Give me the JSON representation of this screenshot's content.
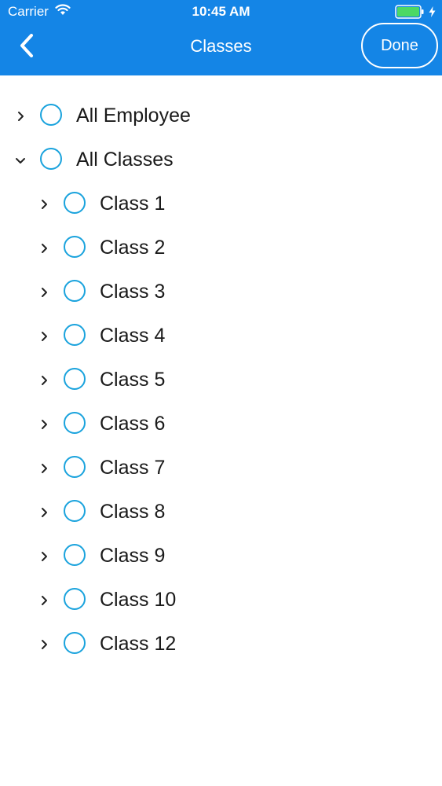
{
  "status_bar": {
    "carrier": "Carrier",
    "time": "10:45 AM",
    "battery_level": 1.0
  },
  "nav": {
    "title": "Classes",
    "done_label": "Done"
  },
  "colors": {
    "header_bg": "#1485e6",
    "radio_border": "#1aa3dd",
    "battery_fill": "#4cd964"
  },
  "tree": {
    "root_items": [
      {
        "label": "All Employee",
        "expanded": false
      },
      {
        "label": "All Classes",
        "expanded": true
      }
    ],
    "classes": [
      {
        "label": "Class 1"
      },
      {
        "label": "Class 2"
      },
      {
        "label": "Class 3"
      },
      {
        "label": "Class 4"
      },
      {
        "label": "Class 5"
      },
      {
        "label": "Class 6"
      },
      {
        "label": "Class 7"
      },
      {
        "label": "Class 8"
      },
      {
        "label": "Class 9"
      },
      {
        "label": "Class 10"
      },
      {
        "label": "Class 12"
      }
    ]
  }
}
